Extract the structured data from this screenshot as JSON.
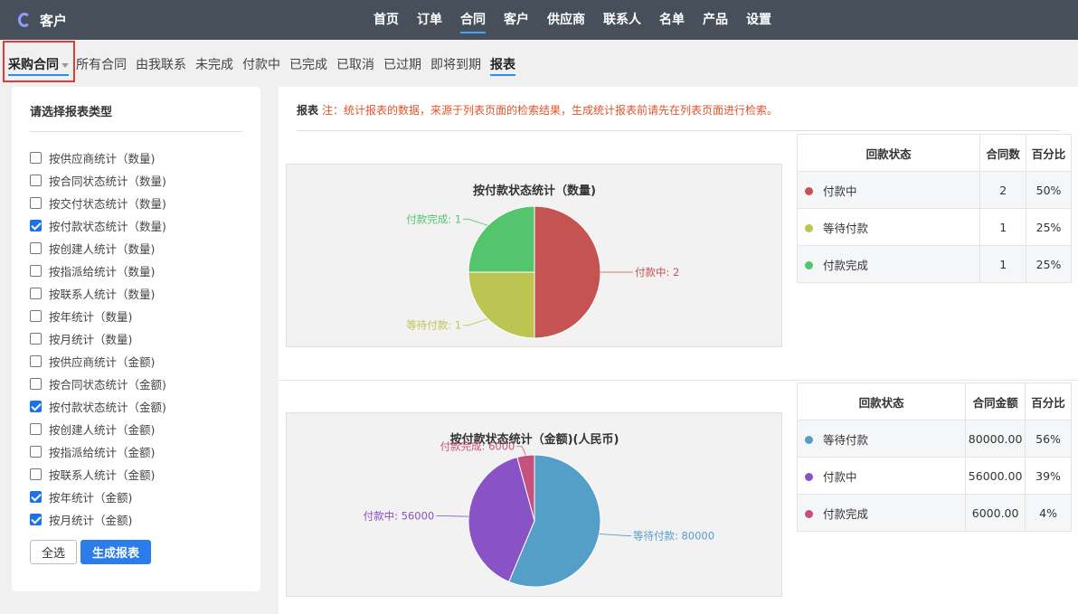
{
  "app": {
    "name": "客户"
  },
  "nav": {
    "items": [
      "首页",
      "订单",
      "合同",
      "客户",
      "供应商",
      "联系人",
      "名单",
      "产品",
      "设置"
    ],
    "active": "合同"
  },
  "subtabs": {
    "items": [
      "采购合同",
      "所有合同",
      "由我联系",
      "未完成",
      "付款中",
      "已完成",
      "已取消",
      "已过期",
      "即将到期",
      "报表"
    ]
  },
  "left": {
    "title": "请选择报表类型",
    "options": [
      {
        "label": "按供应商统计（数量)",
        "checked": false
      },
      {
        "label": "按合同状态统计（数量)",
        "checked": false
      },
      {
        "label": "按交付状态统计（数量)",
        "checked": false
      },
      {
        "label": "按付款状态统计（数量)",
        "checked": true
      },
      {
        "label": "按创建人统计（数量)",
        "checked": false
      },
      {
        "label": "按指派给统计（数量)",
        "checked": false
      },
      {
        "label": "按联系人统计（数量)",
        "checked": false
      },
      {
        "label": "按年统计（数量)",
        "checked": false
      },
      {
        "label": "按月统计（数量)",
        "checked": false
      },
      {
        "label": "按供应商统计（金额)",
        "checked": false
      },
      {
        "label": "按合同状态统计（金额)",
        "checked": false
      },
      {
        "label": "按付款状态统计（金额)",
        "checked": true
      },
      {
        "label": "按创建人统计（金额)",
        "checked": false
      },
      {
        "label": "按指派给统计（金额)",
        "checked": false
      },
      {
        "label": "按联系人统计（金额)",
        "checked": false
      },
      {
        "label": "按年统计（金额)",
        "checked": true
      },
      {
        "label": "按月统计（金额)",
        "checked": true
      }
    ],
    "select_all_label": "全选",
    "generate_label": "生成报表"
  },
  "report": {
    "label": "报表",
    "note": "注：统计报表的数据，来源于列表页面的检索结果，生成统计报表前请先在列表页面进行检索。"
  },
  "chart_data": [
    {
      "type": "pie",
      "title": "按付款状态统计（数量)",
      "slices": [
        {
          "label": "付款中",
          "value": 2,
          "color": "#c45352"
        },
        {
          "label": "等待付款",
          "value": 1,
          "color": "#bcc552"
        },
        {
          "label": "付款完成",
          "value": 1,
          "color": "#54c56d"
        }
      ],
      "table": {
        "headers": [
          "回款状态",
          "合同数",
          "百分比"
        ],
        "rows": [
          {
            "name": "付款中",
            "value": "2",
            "percent": "50%",
            "color": "#c45352"
          },
          {
            "name": "等待付款",
            "value": "1",
            "percent": "25%",
            "color": "#bcc552"
          },
          {
            "name": "付款完成",
            "value": "1",
            "percent": "25%",
            "color": "#54c56d"
          }
        ]
      }
    },
    {
      "type": "pie",
      "title": "按付款状态统计（金额)(人民币)",
      "slices": [
        {
          "label": "等待付款",
          "value": 80000,
          "color": "#549ec8"
        },
        {
          "label": "付款中",
          "value": 56000,
          "color": "#8952c5"
        },
        {
          "label": "付款完成",
          "value": 6000,
          "color": "#c5527d"
        }
      ],
      "table": {
        "headers": [
          "回款状态",
          "合同金额",
          "百分比"
        ],
        "rows": [
          {
            "name": "等待付款",
            "value": "80000.00",
            "percent": "56%",
            "color": "#549ec8"
          },
          {
            "name": "付款中",
            "value": "56000.00",
            "percent": "39%",
            "color": "#8952c5"
          },
          {
            "name": "付款完成",
            "value": "6000.00",
            "percent": "4%",
            "color": "#c5527d"
          }
        ]
      }
    }
  ]
}
